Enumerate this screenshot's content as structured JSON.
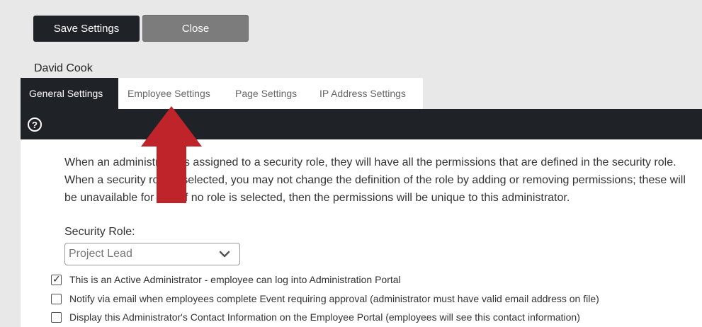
{
  "toolbar": {
    "save_label": "Save Settings",
    "close_label": "Close"
  },
  "user": {
    "name": "David Cook"
  },
  "tabs": [
    {
      "label": "General Settings",
      "active": true
    },
    {
      "label": "Employee Settings",
      "active": false
    },
    {
      "label": "Page Settings",
      "active": false
    },
    {
      "label": "IP Address Settings",
      "active": false
    }
  ],
  "help": {
    "icon": "question-circle-icon",
    "glyph": "?"
  },
  "content": {
    "description": "When an administrator is assigned to a security role, they will have all the permissions that are defined in the security role. When a security role is selected, you may not change the definition of the role by adding or removing permissions; these will be unavailable for edit. If no role is selected, then the permissions will be unique to this administrator.",
    "security_role_label": "Security Role:",
    "security_role_value": "Project Lead",
    "checkboxes": [
      {
        "label": "This is an Active Administrator - employee can log into Administration Portal",
        "checked": true
      },
      {
        "label": "Notify via email when employees complete Event requiring approval (administrator must have valid email address on file)",
        "checked": false
      },
      {
        "label": "Display this Administrator's Contact Information on the Employee Portal (employees will see this contact information)",
        "checked": false
      }
    ]
  },
  "annotation": {
    "arrow_color": "#c0242b"
  },
  "colors": {
    "dark": "#1f2226",
    "close_button": "#7c7c7c",
    "background": "#e8e8e8"
  }
}
